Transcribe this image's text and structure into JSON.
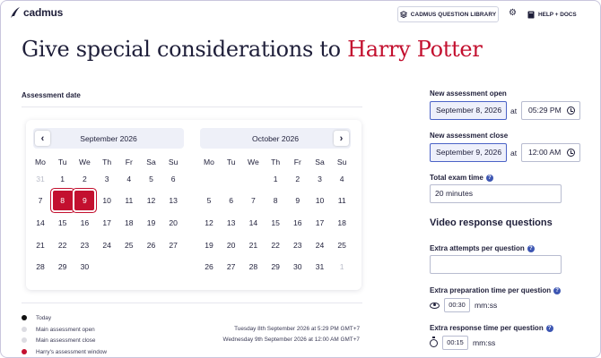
{
  "header": {
    "logo_text": "cadmus",
    "library_button": "CADMUS QUESTION LIBRARY",
    "help_button": "HELP + DOCS"
  },
  "page": {
    "title_prefix": "Give special considerations to ",
    "student_name": "Harry Potter"
  },
  "assessment_date": {
    "label": "Assessment date",
    "weekdays": [
      "Mo",
      "Tu",
      "We",
      "Th",
      "Fr",
      "Sa",
      "Su"
    ],
    "months": [
      {
        "name": "September 2026",
        "rows": [
          [
            "31",
            "1",
            "2",
            "3",
            "4",
            "5",
            "6"
          ],
          [
            "7",
            "8",
            "9",
            "10",
            "11",
            "12",
            "13"
          ],
          [
            "14",
            "15",
            "16",
            "17",
            "18",
            "19",
            "20"
          ],
          [
            "21",
            "22",
            "23",
            "24",
            "25",
            "26",
            "27"
          ],
          [
            "28",
            "29",
            "30",
            "",
            "",
            "",
            ""
          ]
        ],
        "muted": [
          "31"
        ],
        "selected": [
          "8",
          "9"
        ]
      },
      {
        "name": "October 2026",
        "rows": [
          [
            "",
            "",
            "",
            "1",
            "2",
            "3",
            "4"
          ],
          [
            "5",
            "6",
            "7",
            "8",
            "9",
            "10",
            "11"
          ],
          [
            "12",
            "13",
            "14",
            "15",
            "16",
            "17",
            "18"
          ],
          [
            "19",
            "20",
            "21",
            "22",
            "23",
            "24",
            "25"
          ],
          [
            "26",
            "27",
            "28",
            "29",
            "30",
            "31",
            "1"
          ]
        ],
        "muted_last": true,
        "selected": []
      }
    ],
    "legend": [
      {
        "label": "Today",
        "value": "",
        "color": "#111111"
      },
      {
        "label": "Main assessment open",
        "value": "Tuesday 8th September 2026 at 5:29 PM GMT+7",
        "color": "#dcdce2"
      },
      {
        "label": "Main assessment close",
        "value": "Wednesday 9th September 2026 at 12:00 AM GMT+7",
        "color": "#dcdce2"
      },
      {
        "label": "Harry's assessment window",
        "value": "",
        "color": "#c3102f"
      }
    ]
  },
  "settings": {
    "open_label": "New assessment open",
    "open_date": "September 8, 2026",
    "open_at": "at",
    "open_time": "05:29 PM",
    "close_label": "New assessment close",
    "close_date": "September 9, 2026",
    "close_at": "at",
    "close_time": "12:00 AM",
    "exam_label": "Total exam time",
    "exam_value": "20 minutes",
    "video_heading": "Video response questions",
    "attempts_label": "Extra attempts per question",
    "attempts_value": "",
    "prep_label": "Extra preparation time per question",
    "prep_value": "00:30",
    "prep_unit": "mm:ss",
    "response_label": "Extra response time per question",
    "response_value": "00:15",
    "response_unit": "mm:ss"
  },
  "colors": {
    "accent_red": "#c3102f",
    "primary_blue": "#3d56b2"
  }
}
